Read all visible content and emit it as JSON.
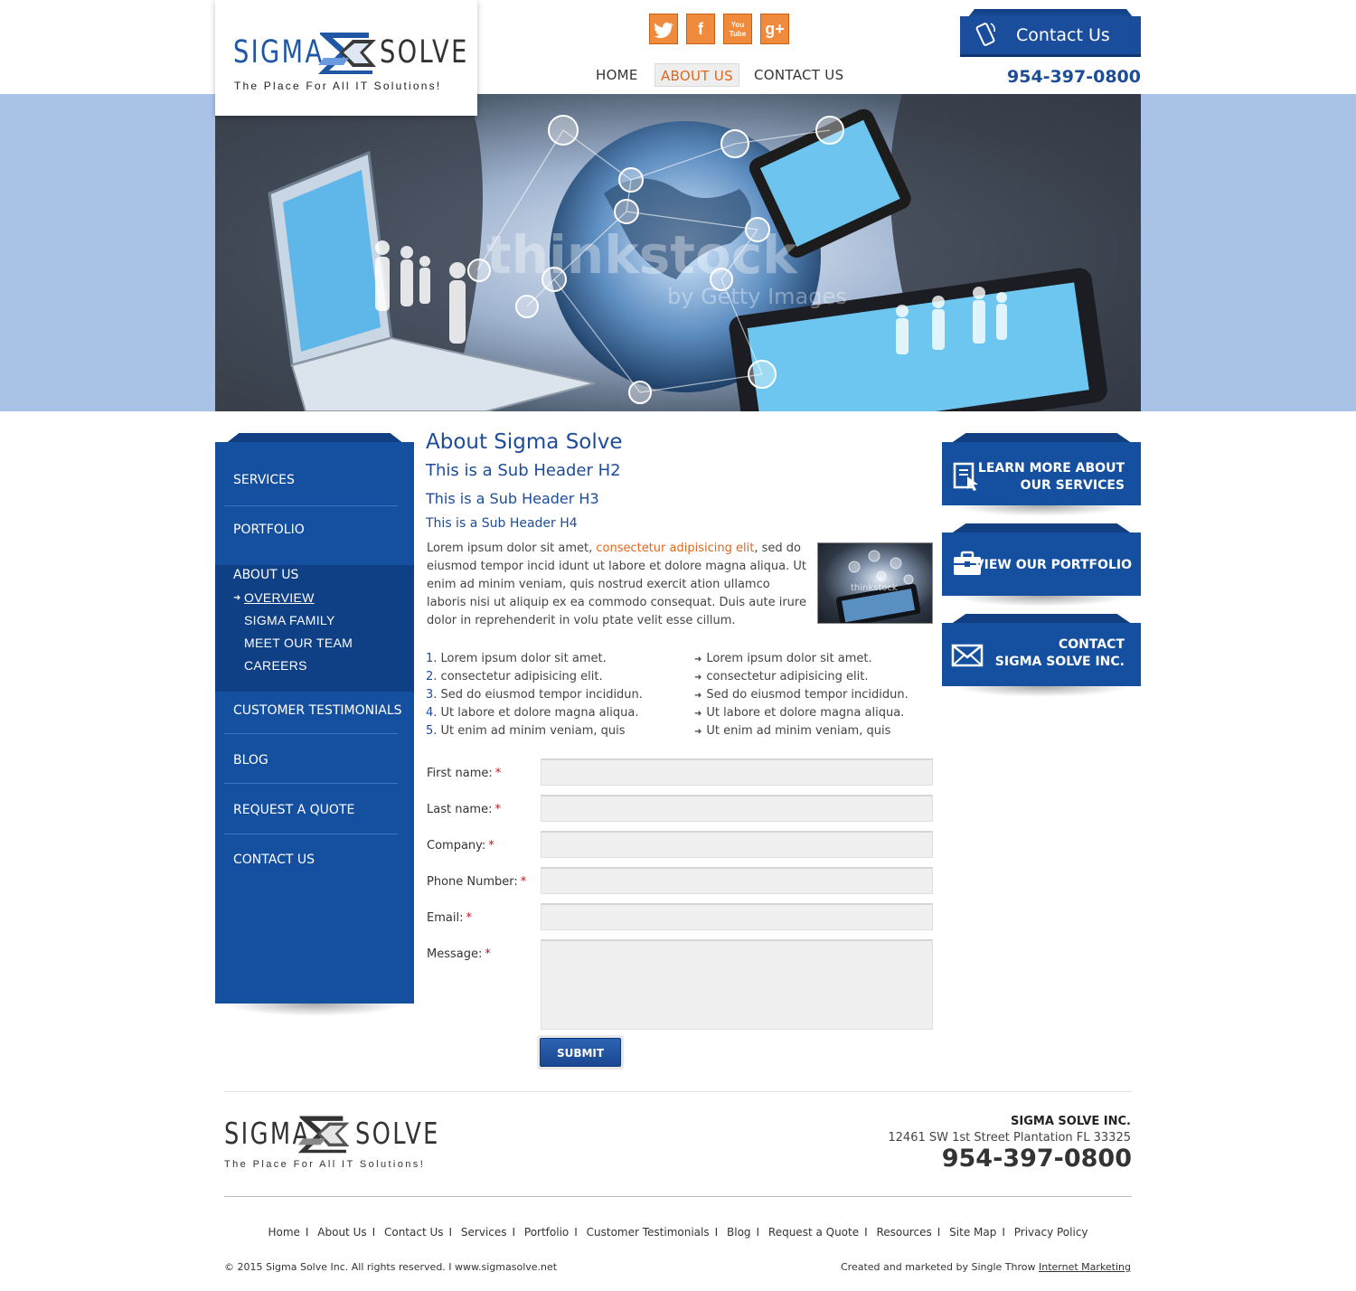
{
  "brand": {
    "logo_left": "SIGMA",
    "logo_right": "SOLVE",
    "tagline": "The Place For All IT Solutions!",
    "primary_color": "#1550a0",
    "accent_color": "#e2661b",
    "social_color": "#f08a3c"
  },
  "header": {
    "social": [
      {
        "name": "twitter-icon",
        "glyph": "t"
      },
      {
        "name": "facebook-icon",
        "glyph": "f"
      },
      {
        "name": "youtube-icon",
        "glyph": "You Tube"
      },
      {
        "name": "google-plus-icon",
        "glyph": "g+"
      }
    ],
    "nav": [
      "HOME",
      "ABOUT US",
      "CONTACT US"
    ],
    "nav_active": "ABOUT US",
    "contact_button": "Contact Us",
    "phone": "954-397-0800"
  },
  "hero": {
    "watermark": "thinkstock",
    "watermark_sub": "by Getty Images"
  },
  "sidebar": {
    "items": [
      "SERVICES",
      "PORTFOLIO",
      "ABOUT US",
      "CUSTOMER TESTIMONIALS",
      "BLOG",
      "REQUEST A QUOTE",
      "CONTACT US"
    ],
    "sub_items": [
      "OVERVIEW",
      "SIGMA FAMILY",
      "MEET OUR TEAM",
      "CAREERS"
    ],
    "active_item": "ABOUT US",
    "active_sub": "OVERVIEW"
  },
  "content": {
    "h1": "About Sigma Solve",
    "h2": "This is a Sub Header H2",
    "h3": "This is a Sub Header H3",
    "h4": "This is a Sub Header H4",
    "para_before": "Lorem ipsum dolor sit amet, ",
    "para_link": "consectetur adipisicing elit",
    "para_after": ", sed do eiusmod tempor incid idunt ut labore et dolore magna aliqua. Ut enim ad minim veniam, quis nostrud exercit ation ullamco laboris nisi ut aliquip ex ea commodo consequat. Duis aute irure dolor in reprehenderit in volu ptate velit esse cillum.",
    "thumb_watermark": "thinkstock",
    "ordered_list": [
      "Lorem ipsum dolor sit amet.",
      "consectetur adipisicing elit.",
      "Sed do eiusmod tempor incididun.",
      "Ut labore et dolore magna aliqua.",
      "Ut enim ad minim veniam, quis"
    ],
    "ordered_numbers": [
      "1.",
      "2.",
      "3.",
      "4.",
      "5."
    ],
    "bullet_list": [
      "Lorem ipsum dolor sit amet.",
      "consectetur adipisicing elit.",
      "Sed do eiusmod tempor incididun.",
      "Ut labore et dolore magna aliqua.",
      "Ut enim ad minim veniam, quis"
    ]
  },
  "form": {
    "fields": [
      {
        "label": "First name:",
        "value": ""
      },
      {
        "label": "Last name:",
        "value": ""
      },
      {
        "label": "Company:",
        "value": ""
      },
      {
        "label": "Phone Number:",
        "value": ""
      },
      {
        "label": "Email:",
        "value": ""
      }
    ],
    "message_label": "Message:",
    "required_mark": "*",
    "submit": "SUBMIT"
  },
  "promos": [
    {
      "line1": "LEARN MORE ABOUT",
      "line2": "OUR SERVICES"
    },
    {
      "line1": "VIEW OUR PORTFOLIO",
      "line2": ""
    },
    {
      "line1": "CONTACT",
      "line2": "SIGMA SOLVE INC."
    }
  ],
  "footer": {
    "company": "SIGMA SOLVE INC.",
    "address": "12461 SW 1st Street Plantation FL 33325",
    "phone": "954-397-0800",
    "links": [
      "Home",
      "About Us",
      "Contact Us",
      "Services",
      "Portfolio",
      "Customer Testimonials",
      "Blog",
      "Request a Quote",
      "Resources",
      "Site Map",
      "Privacy Policy"
    ],
    "link_separator": "I",
    "copyright": "© 2015 Sigma Solve Inc. All rights reserved.  I  www.sigmasolve.net",
    "credit_prefix": "Created and marketed by Single Throw ",
    "credit_link": "Internet Marketing"
  }
}
